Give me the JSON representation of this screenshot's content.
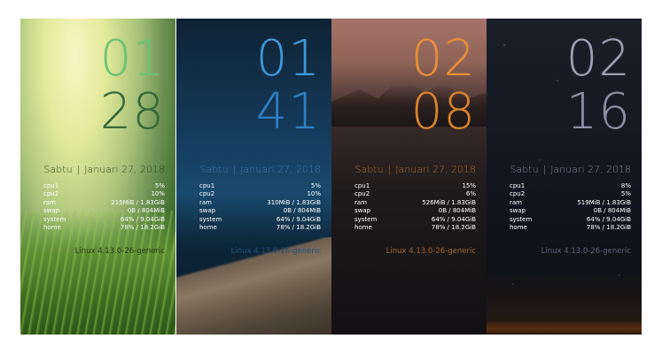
{
  "screens": [
    {
      "hour": "01",
      "minute": "28",
      "day": "Sabtu",
      "date": "Januari 27, 2018",
      "stats": [
        {
          "label": "cpu1",
          "value": "5%"
        },
        {
          "label": "cpu2",
          "value": "10%"
        },
        {
          "label": "ram",
          "value": "215MiB / 1.83GiB"
        },
        {
          "label": "swap",
          "value": "0B / 804MiB"
        },
        {
          "label": "system",
          "value": "64% / 9.04GiB"
        },
        {
          "label": "home",
          "value": "78% / 18.2GiB"
        }
      ],
      "kernel": "Linux 4.13.0-26-generic",
      "colors": {
        "hour": "#6cc274",
        "minute": "#36683a",
        "date": "#2e4a20",
        "stats": "#ffffff",
        "kernel": "#233c18"
      }
    },
    {
      "hour": "01",
      "minute": "41",
      "day": "Sabtu",
      "date": "Januari 27, 2018",
      "stats": [
        {
          "label": "cpu1",
          "value": "5%"
        },
        {
          "label": "cpu2",
          "value": "10%"
        },
        {
          "label": "ram",
          "value": "310MiB / 1.83GiB"
        },
        {
          "label": "swap",
          "value": "0B / 804MiB"
        },
        {
          "label": "system",
          "value": "64% / 9.04GiB"
        },
        {
          "label": "home",
          "value": "78% / 18.2GiB"
        }
      ],
      "kernel": "Linux 4.13.0-26-generic",
      "colors": {
        "hour": "#3f97d8",
        "minute": "#2f7fc4",
        "date": "#3c78b2",
        "stats": "#ffffff",
        "kernel": "#1d527e"
      }
    },
    {
      "hour": "02",
      "minute": "08",
      "day": "Sabtu",
      "date": "Januari 27, 2018",
      "stats": [
        {
          "label": "cpu1",
          "value": "15%"
        },
        {
          "label": "cpu2",
          "value": "6%"
        },
        {
          "label": "ram",
          "value": "526MiB / 1.83GiB"
        },
        {
          "label": "swap",
          "value": "0B / 804MiB"
        },
        {
          "label": "system",
          "value": "64% / 9.04GiB"
        },
        {
          "label": "home",
          "value": "78% / 18.2GiB"
        }
      ],
      "kernel": "Linux 4.13.0-26-generic",
      "colors": {
        "hour": "#e88f37",
        "minute": "#d9832e",
        "date": "#b26d2c",
        "stats": "#ffffff",
        "kernel": "#a3652a"
      }
    },
    {
      "hour": "02",
      "minute": "16",
      "day": "Sabtu",
      "date": "Januari 27, 2018",
      "stats": [
        {
          "label": "cpu1",
          "value": "8%"
        },
        {
          "label": "cpu2",
          "value": "5%"
        },
        {
          "label": "ram",
          "value": "519MiB / 1.83GiB"
        },
        {
          "label": "swap",
          "value": "0B / 804MiB"
        },
        {
          "label": "system",
          "value": "64% / 9.04GiB"
        },
        {
          "label": "home",
          "value": "78% / 18.2GiB"
        }
      ],
      "kernel": "Linux 4.13.0-26-generic",
      "colors": {
        "hour": "#9aa1b4",
        "minute": "#8a91a5",
        "date": "#7d8498",
        "stats": "#ffffff",
        "kernel": "#5c6274"
      }
    }
  ]
}
